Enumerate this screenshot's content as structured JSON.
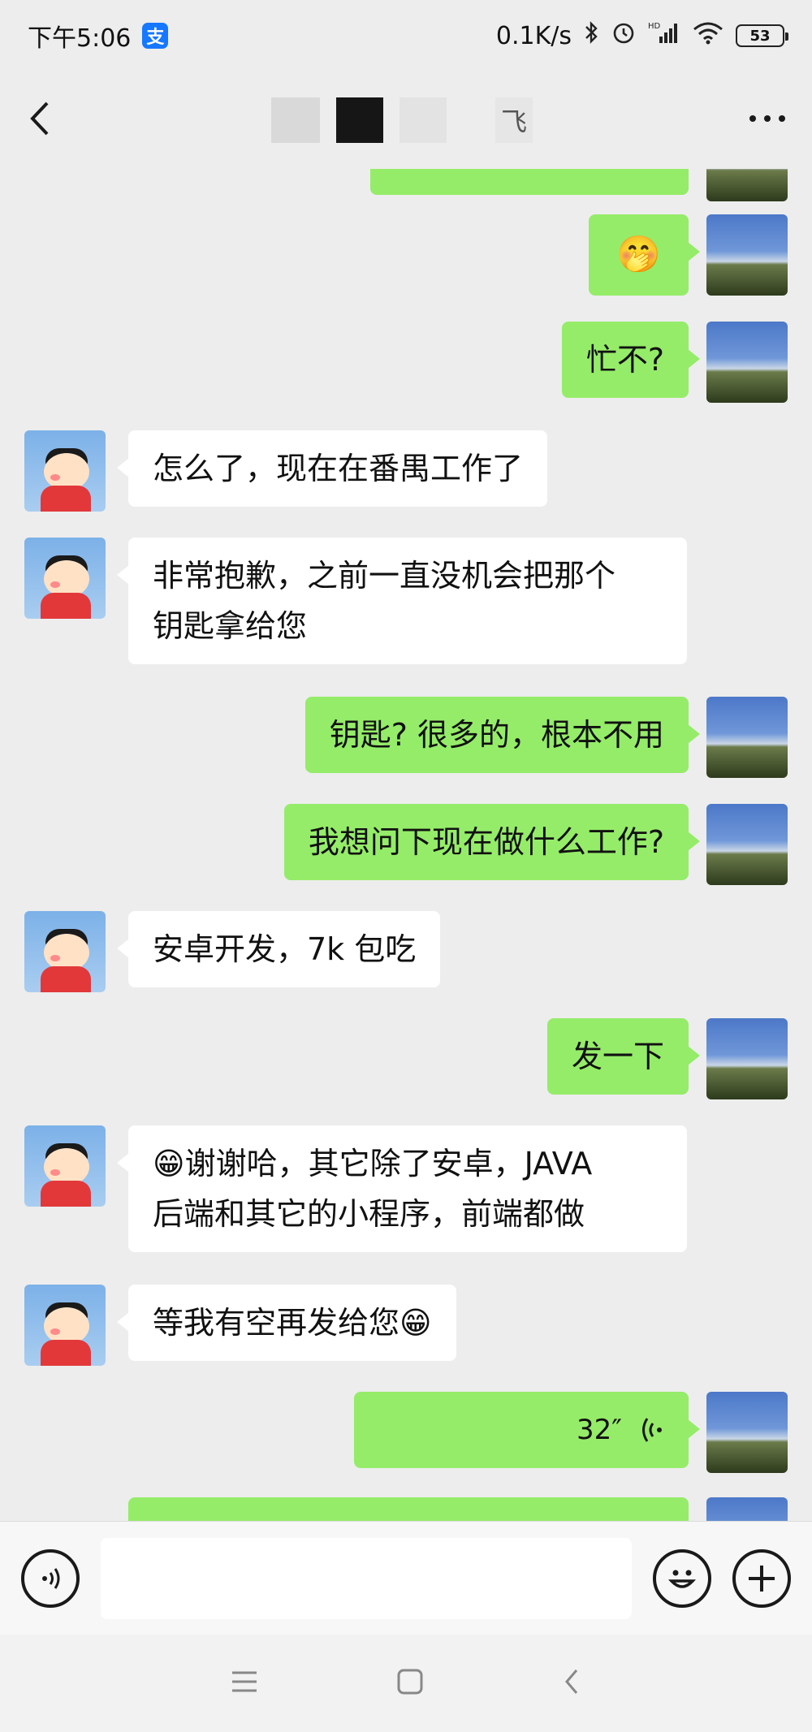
{
  "status_bar": {
    "time": "下午5:06",
    "alipay_badge": "支",
    "net_speed": "0.1K/s",
    "battery": "53"
  },
  "header": {
    "title_visible_char": "飞"
  },
  "messages": [
    {
      "side": "me",
      "type": "emoji",
      "text": "🤭"
    },
    {
      "side": "me",
      "type": "text",
      "text": "忙不?"
    },
    {
      "side": "friend",
      "type": "text",
      "text": "怎么了，现在在番禺工作了"
    },
    {
      "side": "friend",
      "type": "text",
      "line1": "非常抱歉，之前一直没机会把那个",
      "line2": "钥匙拿给您"
    },
    {
      "side": "me",
      "type": "text",
      "text": "钥匙? 很多的，根本不用"
    },
    {
      "side": "me",
      "type": "text",
      "text": "我想问下现在做什么工作?"
    },
    {
      "side": "friend",
      "type": "text",
      "text": "安卓开发，7k 包吃"
    },
    {
      "side": "me",
      "type": "text",
      "text": "发一下"
    },
    {
      "side": "friend",
      "type": "text",
      "emoji": "😁",
      "line1": "谢谢哈，其它除了安卓，JAVA",
      "line2": "后端和其它的小程序，前端都做"
    },
    {
      "side": "friend",
      "type": "text",
      "text": "等我有空再发给您",
      "emoji": "😁"
    },
    {
      "side": "me",
      "type": "voice",
      "duration": "32″"
    }
  ],
  "input_bar": {
    "placeholder": ""
  },
  "colors": {
    "my_bubble": "#95ec69",
    "friend_bubble": "#ffffff",
    "background": "#ededed"
  }
}
